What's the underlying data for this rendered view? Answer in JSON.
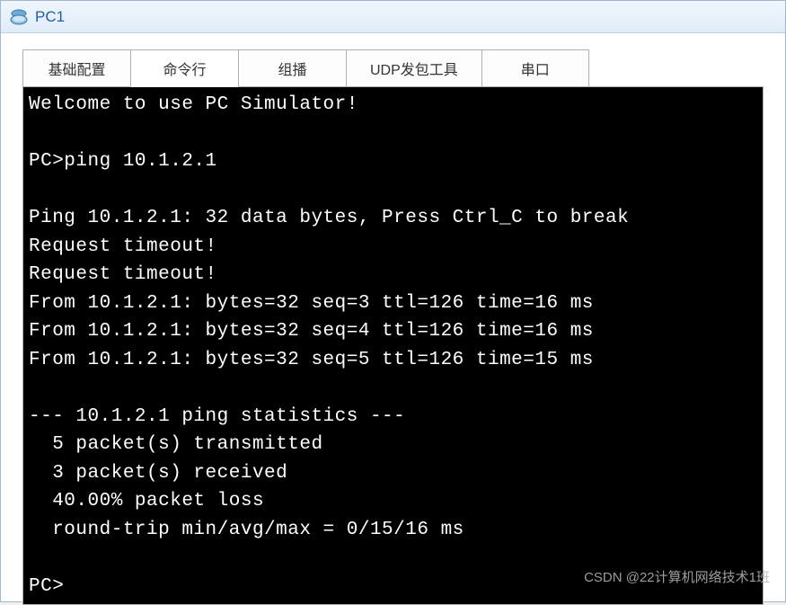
{
  "window": {
    "title": "PC1",
    "icon_name": "pc-icon"
  },
  "tabs": {
    "items": [
      {
        "label": "基础配置",
        "active": false
      },
      {
        "label": "命令行",
        "active": true
      },
      {
        "label": "组播",
        "active": false
      },
      {
        "label": "UDP发包工具",
        "active": false
      },
      {
        "label": "串口",
        "active": false
      }
    ]
  },
  "terminal": {
    "lines": [
      "Welcome to use PC Simulator!",
      "",
      "PC>ping 10.1.2.1",
      "",
      "Ping 10.1.2.1: 32 data bytes, Press Ctrl_C to break",
      "Request timeout!",
      "Request timeout!",
      "From 10.1.2.1: bytes=32 seq=3 ttl=126 time=16 ms",
      "From 10.1.2.1: bytes=32 seq=4 ttl=126 time=16 ms",
      "From 10.1.2.1: bytes=32 seq=5 ttl=126 time=15 ms",
      "",
      "--- 10.1.2.1 ping statistics ---",
      "  5 packet(s) transmitted",
      "  3 packet(s) received",
      "  40.00% packet loss",
      "  round-trip min/avg/max = 0/15/16 ms",
      "",
      "PC>"
    ]
  },
  "watermark": {
    "text": "CSDN @22计算机网络技术1班"
  }
}
